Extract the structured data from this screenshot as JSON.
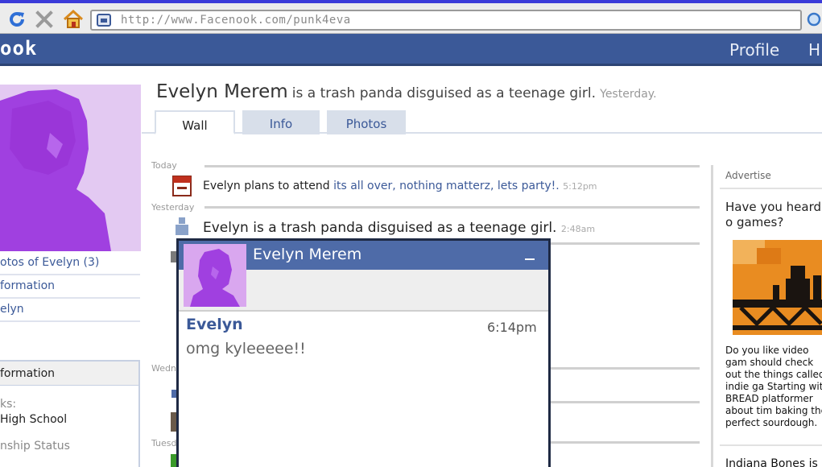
{
  "browser": {
    "url": "http://www.Facenook.com/punk4eva",
    "icons": [
      "refresh-icon",
      "stop-icon",
      "home-icon",
      "favicon-icon",
      "search-icon"
    ]
  },
  "nav": {
    "logo": "ook",
    "links": [
      "Profile",
      "H"
    ]
  },
  "header": {
    "name": "Evelyn Merem",
    "status": "is a trash panda disguised as a teenage girl.",
    "time": "Yesterday."
  },
  "tabs": [
    {
      "label": "Wall",
      "active": true
    },
    {
      "label": "Info",
      "active": false
    },
    {
      "label": "Photos",
      "active": false
    }
  ],
  "left": {
    "links": [
      "otos of Evelyn (3)",
      "formation",
      "elyn"
    ],
    "info_header": "formation",
    "info_label1": "ks:",
    "info_value1": "High School",
    "info_label2": "nship Status"
  },
  "feed": {
    "days": [
      "Today",
      "Yesterday",
      "Wedn",
      "Tuesd"
    ],
    "item1": {
      "text": "Evelyn plans to attend ",
      "link": "its all over, nothing matterz, lets party!.",
      "time": "5:12pm"
    },
    "item2": {
      "text": "Evelyn is a trash panda disguised as a teenage girl.",
      "time": "2:48am"
    }
  },
  "ad": {
    "title": "Advertise",
    "heading": "Have you heard o games?",
    "body": "Do you like video gam should check out the things called indie ga Starting with BREAD platformer about tim baking the perfect sourdough.",
    "heading2": "Indiana Bones is"
  },
  "chat": {
    "title": "Evelyn Merem",
    "sender": "Evelyn",
    "time": "6:14pm",
    "message": "omg kyleeeee!!"
  },
  "colors": {
    "brand": "#3b5998",
    "chat_header": "#4e6ba8",
    "avatar_purple": "#a040e0",
    "ad_orange": "#e98c21"
  }
}
